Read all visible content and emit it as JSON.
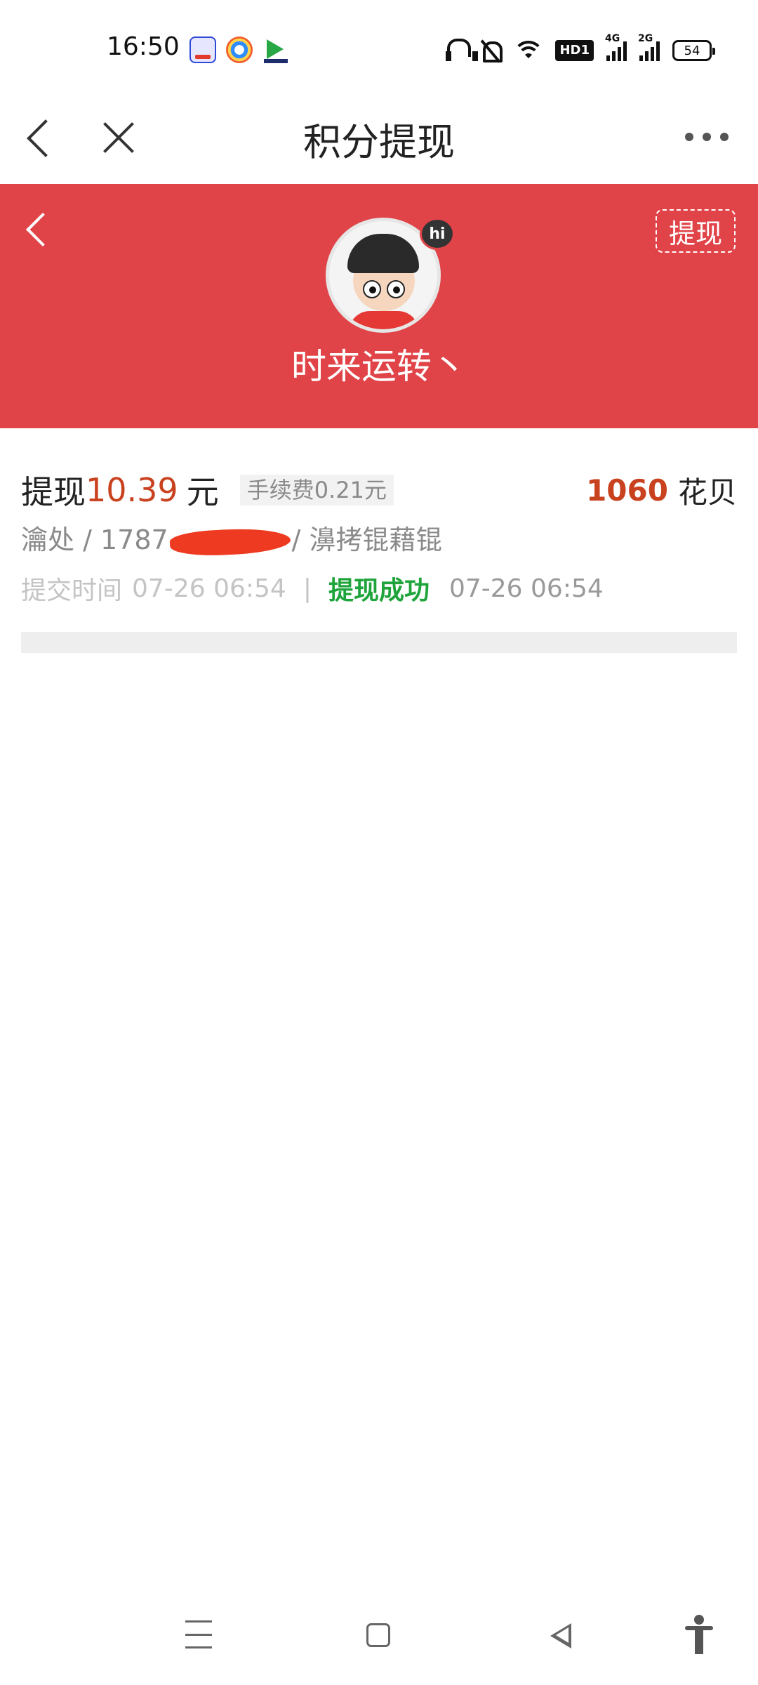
{
  "status_bar": {
    "time": "16:50",
    "hd_label": "HD1",
    "sim1_label": "4G",
    "sim2_label": "2G",
    "battery": "54"
  },
  "header": {
    "title": "积分提现"
  },
  "profile": {
    "username": "时来运转丶",
    "badge": "hi",
    "withdraw_button": "提现"
  },
  "record": {
    "prefix": "提现",
    "amount": "10.39",
    "unit": "元",
    "fee": "手续费0.21元",
    "points": "1060",
    "points_unit": "花贝",
    "account_prefix": "瀹处 / 1787",
    "account_suffix": "/ 濞拷锟藉锟",
    "submit_label": "提交时间",
    "submit_time": "07-26 06:54",
    "separator": "|",
    "status": "提现成功",
    "completed_time": "07-26 06:54"
  },
  "colors": {
    "header_red": "#e14448",
    "amount_orange": "#c9421f",
    "success_green": "#1ea43a"
  },
  "icons": [
    "back-icon",
    "close-icon",
    "more-icon",
    "menu-icon",
    "home-icon",
    "nav-back-icon",
    "accessibility-icon"
  ]
}
